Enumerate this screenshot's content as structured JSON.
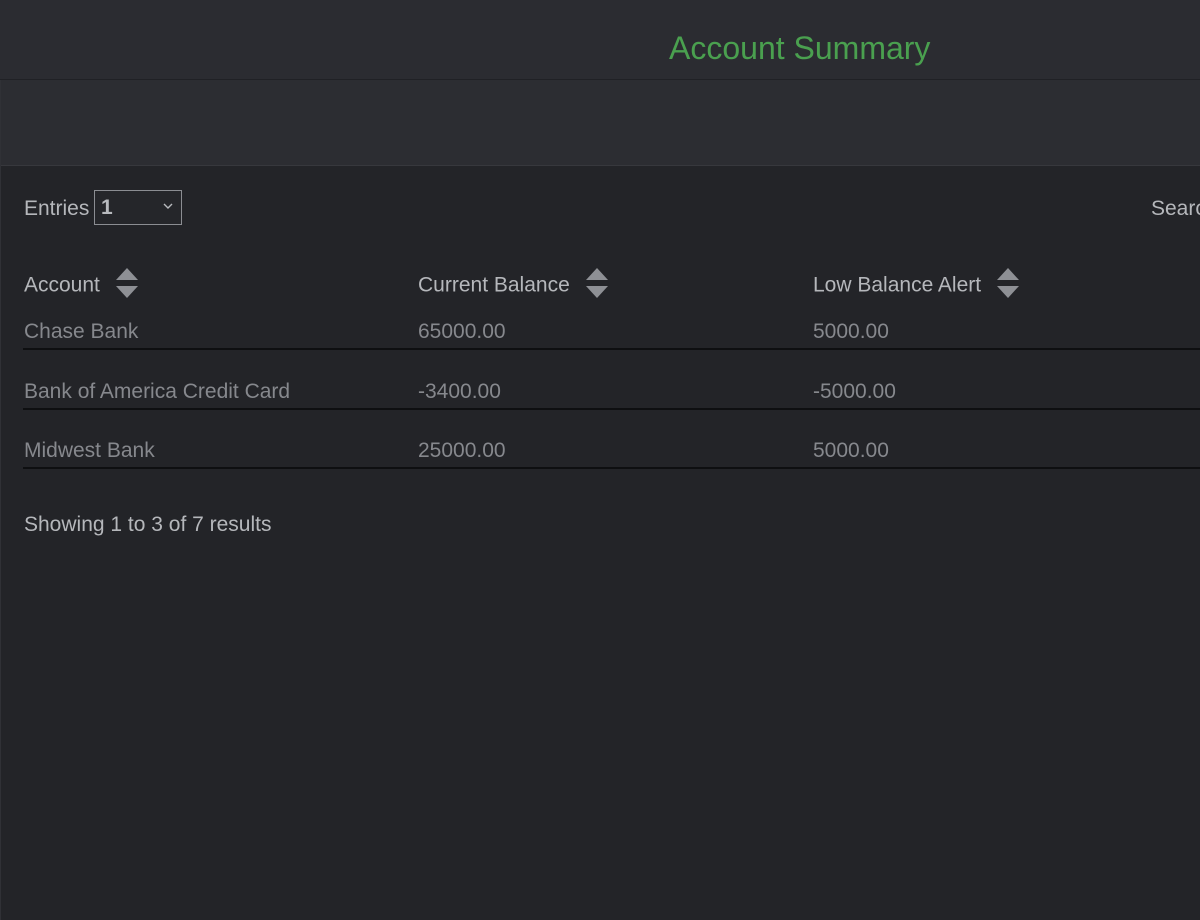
{
  "panel": {
    "title": "Account Summary"
  },
  "controls": {
    "entries_label": "Entries",
    "entries_value": "1",
    "search_label": "Searc"
  },
  "table": {
    "columns": [
      "Account",
      "Current Balance",
      "Low Balance Alert"
    ],
    "rows": [
      [
        "Chase Bank",
        "65000.00",
        "5000.00"
      ],
      [
        "Bank of America Credit Card",
        "-3400.00",
        "-5000.00"
      ],
      [
        "Midwest Bank",
        "25000.00",
        "5000.00"
      ]
    ]
  },
  "footer": {
    "info": "Showing 1 to 3 of 7 results"
  },
  "colors": {
    "title_accent": "#4aa04f",
    "background": "#232428",
    "header_background": "#2c2d32"
  },
  "icons": {
    "sort": "sort-up-down-icon",
    "dropdown": "chevron-down-icon"
  }
}
